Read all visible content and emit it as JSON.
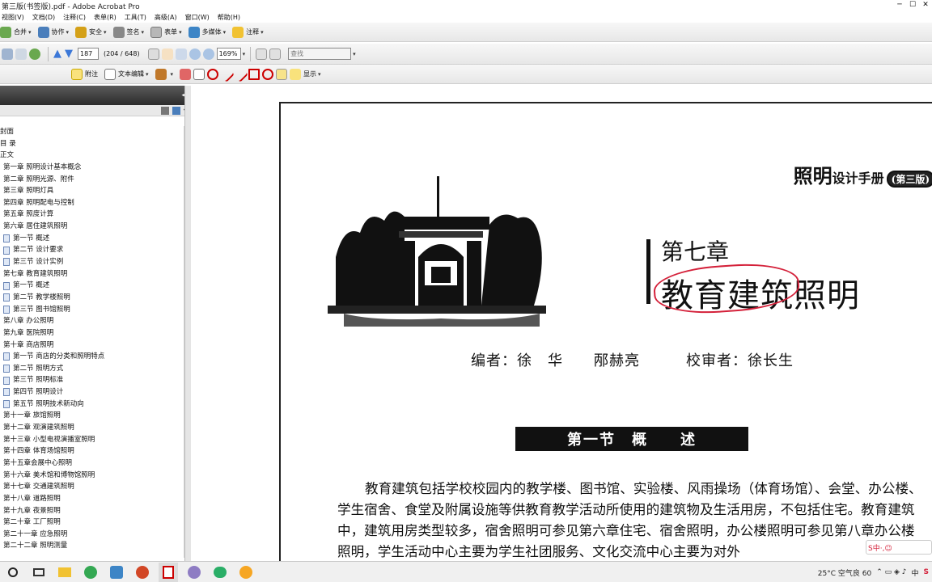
{
  "window": {
    "title": "第三版(书签版).pdf - Adobe Acrobat Pro",
    "controls": [
      "─",
      "☐",
      "✕"
    ]
  },
  "menubar": [
    "视图(V)",
    "文档(D)",
    "注释(C)",
    "表单(R)",
    "工具(T)",
    "高级(A)",
    "窗口(W)",
    "帮助(H)"
  ],
  "toolbar1": {
    "items": [
      "合并",
      "协作",
      "安全",
      "签名",
      "表单",
      "多媒体",
      "注释"
    ]
  },
  "toolbar2": {
    "page_number": "187",
    "page_count": "(204 / 648)",
    "zoom": "169%",
    "search_placeholder": "查找"
  },
  "toolbar3": {
    "items": [
      "附注",
      "文本编辑",
      "显示"
    ]
  },
  "bookmarks": {
    "items": [
      {
        "label": "封面",
        "indent": 0,
        "page": false
      },
      {
        "label": "目 录",
        "indent": 0,
        "page": false
      },
      {
        "label": "正文",
        "indent": 0,
        "page": false
      },
      {
        "label": "第一章 照明设计基本概念",
        "indent": 1,
        "page": false
      },
      {
        "label": "第二章 照明光源、附件",
        "indent": 1,
        "page": false
      },
      {
        "label": "第三章 照明灯具",
        "indent": 1,
        "page": false
      },
      {
        "label": "第四章 照明配电与控制",
        "indent": 1,
        "page": false
      },
      {
        "label": "第五章 照度计算",
        "indent": 1,
        "page": false
      },
      {
        "label": "第六章 居住建筑照明",
        "indent": 1,
        "page": false
      },
      {
        "label": "第一节 概述",
        "indent": 2,
        "page": true
      },
      {
        "label": "第二节 设计要求",
        "indent": 2,
        "page": true
      },
      {
        "label": "第三节 设计实例",
        "indent": 2,
        "page": true
      },
      {
        "label": "第七章 教育建筑照明",
        "indent": 1,
        "page": false
      },
      {
        "label": "第一节 概述",
        "indent": 2,
        "page": true
      },
      {
        "label": "第二节 教学楼照明",
        "indent": 2,
        "page": true
      },
      {
        "label": "第三节 图书馆照明",
        "indent": 2,
        "page": true
      },
      {
        "label": "第八章 办公照明",
        "indent": 1,
        "page": false
      },
      {
        "label": "第九章 医院照明",
        "indent": 1,
        "page": false
      },
      {
        "label": "第十章 商店照明",
        "indent": 1,
        "page": false
      },
      {
        "label": "第一节 商店的分类和照明特点",
        "indent": 2,
        "page": true
      },
      {
        "label": "第二节 照明方式",
        "indent": 2,
        "page": true
      },
      {
        "label": "第三节 照明标准",
        "indent": 2,
        "page": true
      },
      {
        "label": "第四节 照明设计",
        "indent": 2,
        "page": true
      },
      {
        "label": "第五节 照明技术新动向",
        "indent": 2,
        "page": true
      },
      {
        "label": "第十一章 旅馆照明",
        "indent": 1,
        "page": false
      },
      {
        "label": "第十二章 观演建筑照明",
        "indent": 1,
        "page": false
      },
      {
        "label": "第十三章 小型电视演播室照明",
        "indent": 1,
        "page": false
      },
      {
        "label": "第十四章 体育场馆照明",
        "indent": 1,
        "page": false
      },
      {
        "label": "第十五章会展中心照明",
        "indent": 1,
        "page": false
      },
      {
        "label": "第十六章 美术馆和博物馆照明",
        "indent": 1,
        "page": false
      },
      {
        "label": "第十七章 交通建筑照明",
        "indent": 1,
        "page": false
      },
      {
        "label": "第十八章 道路照明",
        "indent": 1,
        "page": false
      },
      {
        "label": "第十九章 夜景照明",
        "indent": 1,
        "page": false
      },
      {
        "label": "第二十章 工厂照明",
        "indent": 1,
        "page": false
      },
      {
        "label": "第二十一章 应急照明",
        "indent": 1,
        "page": false
      },
      {
        "label": "第二十二章 照明测量",
        "indent": 1,
        "page": false
      }
    ]
  },
  "document": {
    "header_big": "照明",
    "header_mid": "设计手册",
    "header_edition": "(第三版)",
    "chapter_number": "第七章",
    "chapter_title": "教育建筑照明",
    "authors": "编者：徐　华　　邴赫亮　　　校审者：徐长生",
    "section_title": "第一节　概　　述",
    "paragraph": "教育建筑包括学校校园内的教学楼、图书馆、实验楼、风雨操场（体育场馆）、会堂、办公楼、学生宿舍、食堂及附属设施等供教育教学活动所使用的建筑物及生活用房，不包括住宅。教育建筑中，建筑用房类型较多，宿舍照明可参见第六章住宅、宿舍照明，办公楼照明可参见第八章办公楼照明，学生活动中心主要为学生社团服务、文化交流中心主要为对外"
  },
  "taskbar": {
    "weather": "25°C 空气良 60",
    "ime": "中",
    "ime_bar": "S中·,☺"
  }
}
